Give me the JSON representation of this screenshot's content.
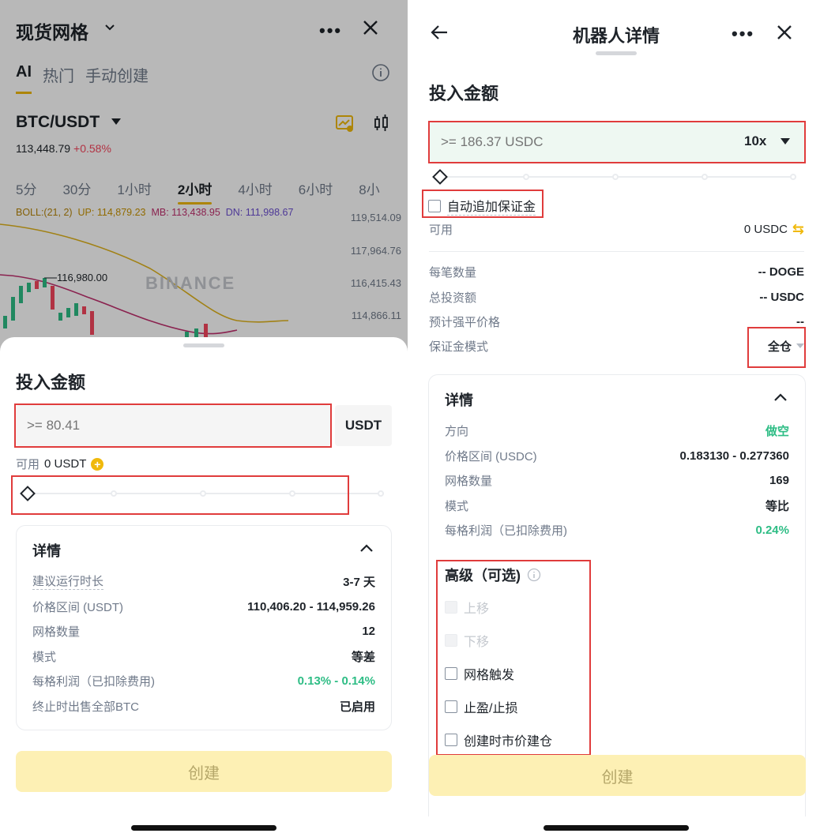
{
  "left": {
    "header": {
      "title": "现货网格"
    },
    "tabs": [
      {
        "label": "AI",
        "active": true
      },
      {
        "label": "热门",
        "active": false
      },
      {
        "label": "手动创建",
        "active": false
      }
    ],
    "pair": {
      "symbol": "BTC/USDT",
      "price": "113,448.79",
      "change": "+0.58%"
    },
    "timeframes": [
      {
        "label": "5分",
        "active": false
      },
      {
        "label": "30分",
        "active": false
      },
      {
        "label": "1小时",
        "active": false
      },
      {
        "label": "2小时",
        "active": true
      },
      {
        "label": "4小时",
        "active": false
      },
      {
        "label": "6小时",
        "active": false
      },
      {
        "label": "8小",
        "active": false
      }
    ],
    "boll": {
      "name": "BOLL:(21, 2)",
      "up": "UP: 114,879.23",
      "mb": "MB: 113,438.95",
      "dn": "DN: 111,998.67"
    },
    "y_axis": [
      "119,514.09",
      "117,964.76",
      "116,415.43",
      "114,866.11"
    ],
    "high_label": "116,980.00",
    "watermark": "BINANCE",
    "sheet": {
      "title": "投入金额",
      "amount_placeholder": ">= 80.41",
      "unit": "USDT",
      "available_label": "可用",
      "available_value": "0 USDT",
      "slider_percent": 0,
      "details": {
        "title": "详情",
        "rows": [
          {
            "k": "建议运行时长",
            "v": "3-7 天"
          },
          {
            "k": "价格区间 (USDT)",
            "v": "110,406.20 - 114,959.26"
          },
          {
            "k": "网格数量",
            "v": "12"
          },
          {
            "k": "模式",
            "v": "等差"
          },
          {
            "k": "每格利润（已扣除费用)",
            "v": "0.13% - 0.14%"
          },
          {
            "k": "终止时出售全部BTC",
            "v": "已启用"
          }
        ]
      },
      "create_label": "创建"
    }
  },
  "right": {
    "header": {
      "title": "机器人详情"
    },
    "sheet": {
      "title": "投入金额",
      "amount_placeholder": ">= 186.37 USDC",
      "leverage": "10x",
      "slider_percent": 0,
      "auto_margin_label": "自动追加保证金",
      "available_label": "可用",
      "available_value": "0 USDC",
      "info_rows": [
        {
          "k": "每笔数量",
          "v": "-- DOGE"
        },
        {
          "k": "总投资额",
          "v": "-- USDC"
        },
        {
          "k": "预计强平价格",
          "v": "--"
        },
        {
          "k": "保证金模式",
          "v": "全仓"
        }
      ],
      "details": {
        "title": "详情",
        "rows": [
          {
            "k": "方向",
            "v": "做空"
          },
          {
            "k": "价格区间 (USDC)",
            "v": "0.183130 - 0.277360"
          },
          {
            "k": "网格数量",
            "v": "169"
          },
          {
            "k": "模式",
            "v": "等比"
          },
          {
            "k": "每格利润（已扣除费用)",
            "v": "0.24%"
          }
        ]
      },
      "advanced": {
        "title": "高级（可选)",
        "options": [
          {
            "label": "上移",
            "disabled": true
          },
          {
            "label": "下移",
            "disabled": true
          },
          {
            "label": "网格触发",
            "disabled": false
          },
          {
            "label": "止盈/止损",
            "disabled": false
          },
          {
            "label": "创建时市价建仓",
            "disabled": false
          }
        ]
      },
      "create_label": "创建"
    }
  },
  "colors": {
    "brand": "#f0b90b",
    "green": "#2ebd85",
    "red": "#f6465d",
    "highlight": "#e03c3c"
  }
}
